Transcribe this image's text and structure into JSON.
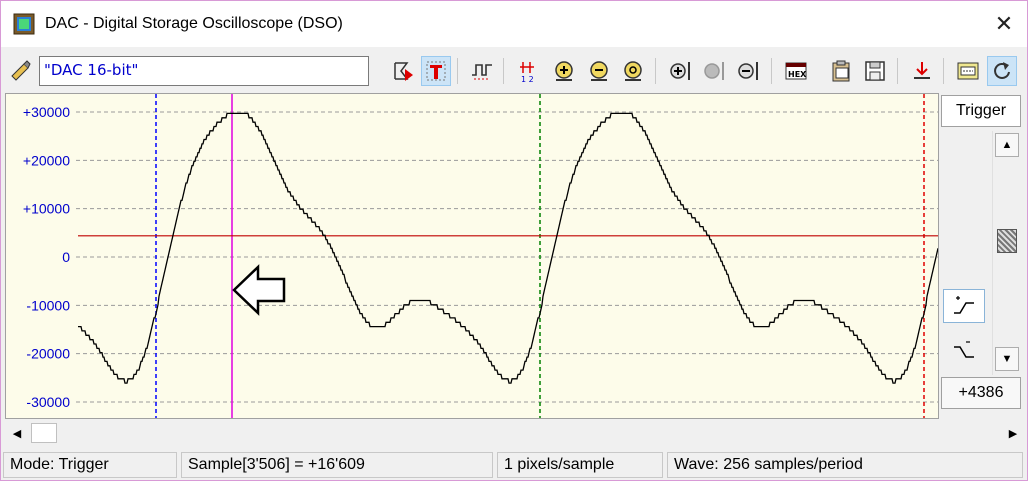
{
  "window": {
    "title": "DAC - Digital Storage Oscilloscope (DSO)",
    "close_glyph": "✕"
  },
  "toolbar": {
    "channel_value": "\"DAC 16-bit\"",
    "buttons": [
      "trigger-marker-icon",
      "trigger-mode-icon",
      "pulse-icon",
      "cursor-icon",
      "zoom-in-icon",
      "zoom-out-icon",
      "zoom-fit-icon",
      "zoom-in-y-icon",
      "center-y-icon",
      "zoom-out-y-icon",
      "hex-display-icon",
      "clipboard-icon",
      "save-icon",
      "download-icon",
      "settings-icon",
      "refresh-icon"
    ]
  },
  "scope": {
    "y_ticks": [
      "+30000",
      "+20000",
      "+10000",
      "0",
      "-10000",
      "-20000",
      "-30000"
    ],
    "y_values": [
      30000,
      20000,
      10000,
      0,
      -10000,
      -20000,
      -30000
    ],
    "colors": {
      "background": "#fdfcea",
      "grid": "#9a9a9a",
      "trace": "#000000",
      "tick_labels": "#0000cc",
      "trigger_level": "#c00000",
      "cursor_blue": "#0000ff",
      "cursor_magenta": "#e000e0",
      "cursor_green": "#008000",
      "cursor_red": "#e00000"
    }
  },
  "trigger_panel": {
    "label": "Trigger",
    "value": "+4386",
    "up_arrow": "▲",
    "down_arrow": "▼"
  },
  "hscroll": {
    "left_arrow": "◀",
    "right_arrow": "▶"
  },
  "status": {
    "mode": "Mode: Trigger",
    "sample": "Sample[3'506] = +16'609",
    "scale": "1 pixels/sample",
    "wave": "Wave: 256 samples/period"
  }
}
